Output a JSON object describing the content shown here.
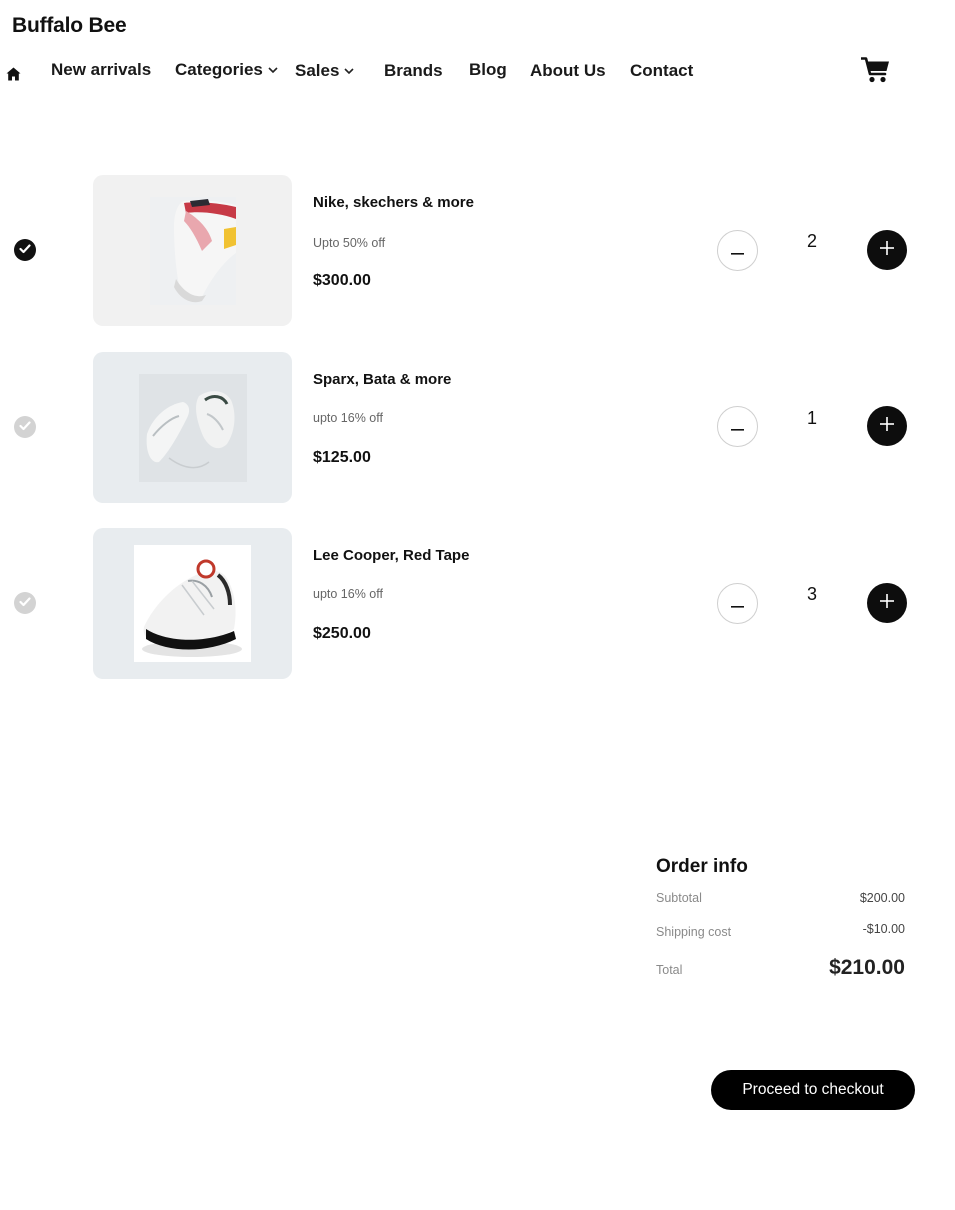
{
  "brand": {
    "name": "Buffalo Bee"
  },
  "nav": {
    "home_icon": "home-icon",
    "items": [
      {
        "label": "New arrivals"
      },
      {
        "label": "Categories",
        "icon": "chevron-down-icon"
      },
      {
        "label": "Sales",
        "icon": "chevron-down-icon"
      },
      {
        "label": "Brands"
      },
      {
        "label": "Blog"
      },
      {
        "label": "About Us"
      },
      {
        "label": "Contact"
      }
    ],
    "cart_icon": "cart-icon"
  },
  "cart": {
    "items": [
      {
        "selected": true,
        "name": "Nike, skechers & more",
        "discount": "Upto 50% off",
        "price": "$300.00",
        "quantity": "2"
      },
      {
        "selected": false,
        "name": "Sparx, Bata & more",
        "discount": "upto 16% off",
        "price": "$125.00",
        "quantity": "1"
      },
      {
        "selected": false,
        "name": "Lee Cooper, Red Tape",
        "discount": "upto 16% off",
        "price": "$250.00",
        "quantity": "3"
      }
    ]
  },
  "order": {
    "title": "Order info",
    "subtotal_label": "Subtotal",
    "subtotal_value": "$200.00",
    "shipping_label": "Shipping cost",
    "shipping_value": "-$10.00",
    "total_label": "Total",
    "total_value": "$210.00"
  },
  "checkout": {
    "label": "Proceed to checkout"
  },
  "colors": {
    "primary": "#000000",
    "thumb_bg": "#e8ecef",
    "check_on": "#111111",
    "check_off": "#d3d3d3"
  }
}
